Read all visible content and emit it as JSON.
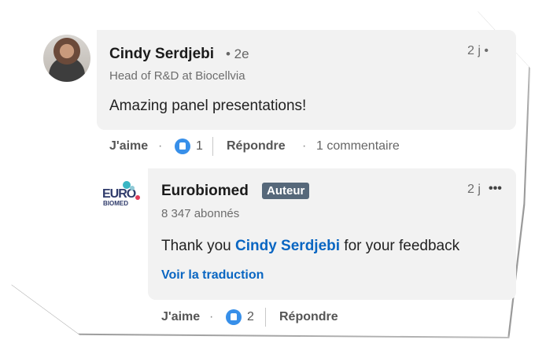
{
  "comment": {
    "author": "Cindy Serdjebi",
    "degree": "• 2e",
    "headline": "Head of R&D at Biocellvia",
    "time": "2 j •",
    "text": "Amazing panel presentations!",
    "actions": {
      "like_label": "J'aime",
      "like_count": "1",
      "reply_label": "Répondre",
      "replies": "1 commentaire"
    }
  },
  "reply": {
    "author": "Eurobiomed",
    "badge": "Auteur",
    "followers": "8 347 abonnés",
    "time": "2 j",
    "more": "•••",
    "text_before": "Thank you ",
    "mention": "Cindy Serdjebi",
    "text_after": " for your feedback",
    "translate": "Voir la traduction",
    "actions": {
      "like_label": "J'aime",
      "like_count": "2",
      "reply_label": "Répondre"
    },
    "logo": {
      "line1": "EURO",
      "line2": "BIOMED"
    }
  },
  "colors": {
    "link": "#0a66c2",
    "like": "#378fe9",
    "bubble": "#f2f2f2",
    "badge": "#56687a"
  }
}
